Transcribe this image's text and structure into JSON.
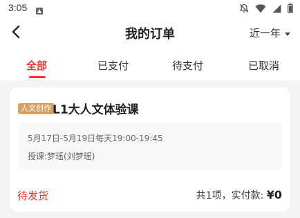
{
  "status_bar": {
    "time": "3:05",
    "icons": [
      "notification-icon",
      "mute-icon",
      "wifi-icon",
      "signal-icon",
      "battery-icon"
    ]
  },
  "header": {
    "title": "我的订单",
    "back_icon": "chevron-left-icon",
    "date_filter": "近一年",
    "date_filter_icon": "caret-down-icon"
  },
  "tabs": [
    {
      "label": "全部",
      "active": true
    },
    {
      "label": "已支付",
      "active": false
    },
    {
      "label": "待支付",
      "active": false
    },
    {
      "label": "已取消",
      "active": false
    }
  ],
  "order": {
    "category_tag": "人文创作",
    "title": "L1大人文体验课",
    "schedule": "5月17日-5月19日每天19:00-19:45",
    "teacher": "授课:梦瑶(刘梦瑶)",
    "status": "待发货",
    "summary_prefix": "共1项，实付款: ",
    "amount": "¥0"
  },
  "colors": {
    "accent": "#e53935",
    "tag_bg": "#d9a066",
    "page_bg": "#f4f4f4",
    "card_bg": "#ffffff",
    "schedule_bg": "#f7f7f7"
  }
}
